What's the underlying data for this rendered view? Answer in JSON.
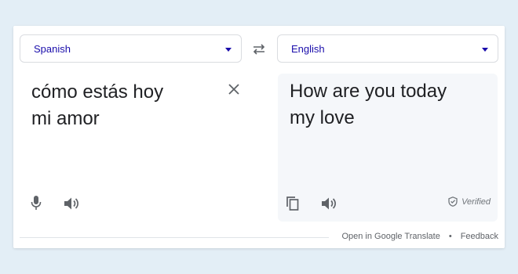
{
  "source": {
    "language": "Spanish",
    "text_line1": "cómo estás hoy",
    "text_line2": "mi amor"
  },
  "target": {
    "language": "English",
    "text_line1": "How are you today",
    "text_line2": "my love",
    "verified_label": "Verified"
  },
  "footer": {
    "open_link": "Open in Google Translate",
    "separator": "•",
    "feedback_link": "Feedback"
  },
  "icons": {
    "swap": "swap-arrows-icon",
    "clear": "close-icon",
    "mic": "microphone-icon",
    "speaker": "speaker-icon",
    "copy": "copy-icon",
    "verified": "shield-check-icon",
    "dropdown": "caret-down-icon"
  },
  "colors": {
    "page_background": "#e3eef6",
    "language_text": "#1a0dab",
    "icon": "#5f6368",
    "target_panel": "#f5f7fa"
  }
}
